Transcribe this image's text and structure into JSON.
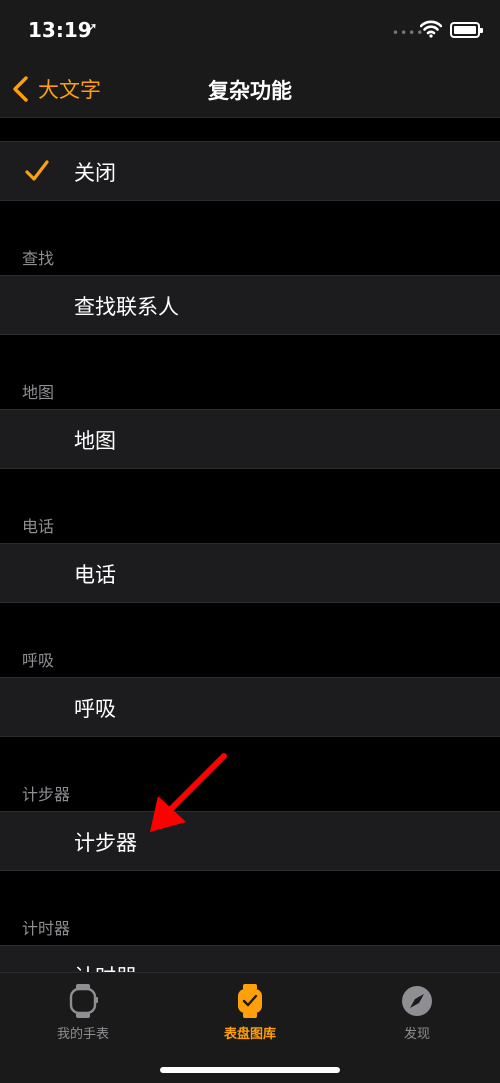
{
  "status": {
    "time": "13:19",
    "location_glyph": "➚"
  },
  "nav": {
    "back_label": "大文字",
    "title": "复杂功能"
  },
  "selected": {
    "label": "关闭"
  },
  "sections": [
    {
      "header": "查找",
      "item": "查找联系人"
    },
    {
      "header": "地图",
      "item": "地图"
    },
    {
      "header": "电话",
      "item": "电话"
    },
    {
      "header": "呼吸",
      "item": "呼吸"
    },
    {
      "header": "计步器",
      "item": "计步器"
    },
    {
      "header": "计时器",
      "item": "计时器"
    }
  ],
  "tabs": [
    {
      "label": "我的手表",
      "icon": "watch-icon",
      "active": false
    },
    {
      "label": "表盘图库",
      "icon": "watch-face-gallery-icon",
      "active": true
    },
    {
      "label": "发现",
      "icon": "compass-icon",
      "active": false
    }
  ],
  "colors": {
    "accent": "#ff9f0a",
    "background": "#000000",
    "row": "#1c1c1e",
    "secondary_text": "#8e8e93",
    "annotation_arrow": "#ff0000"
  }
}
